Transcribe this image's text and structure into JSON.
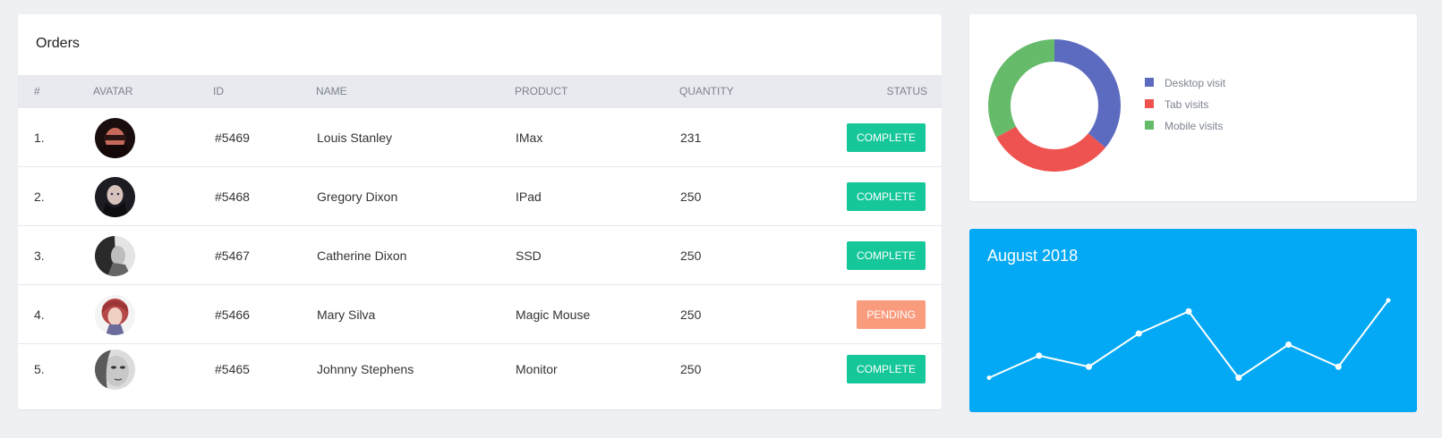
{
  "orders": {
    "title": "Orders",
    "columns": [
      "#",
      "AVATAR",
      "ID",
      "NAME",
      "PRODUCT",
      "QUANTITY",
      "STATUS"
    ],
    "rows": [
      {
        "num": "1.",
        "id": "#5469",
        "name": "Louis Stanley",
        "product": "IMax",
        "quantity": "231",
        "status": "COMPLETE"
      },
      {
        "num": "2.",
        "id": "#5468",
        "name": "Gregory Dixon",
        "product": "IPad",
        "quantity": "250",
        "status": "COMPLETE"
      },
      {
        "num": "3.",
        "id": "#5467",
        "name": "Catherine Dixon",
        "product": "SSD",
        "quantity": "250",
        "status": "COMPLETE"
      },
      {
        "num": "4.",
        "id": "#5466",
        "name": "Mary Silva",
        "product": "Magic Mouse",
        "quantity": "250",
        "status": "PENDING"
      },
      {
        "num": "5.",
        "id": "#5465",
        "name": "Johnny Stephens",
        "product": "Monitor",
        "quantity": "250",
        "status": "COMPLETE"
      }
    ]
  },
  "colors": {
    "complete": "#16c79a",
    "pending": "#f99b7d",
    "desktop": "#5c6bc0",
    "tab": "#ef5350",
    "mobile": "#66bb6a",
    "line_card": "#03a9f4"
  },
  "chart_data": [
    {
      "type": "pie",
      "variant": "donut",
      "series": [
        {
          "name": "Desktop visit",
          "value": 36,
          "color": "#5c6bc0"
        },
        {
          "name": "Tab visits",
          "value": 31,
          "color": "#ef5350"
        },
        {
          "name": "Mobile visits",
          "value": 33,
          "color": "#66bb6a"
        }
      ],
      "legend_position": "right"
    },
    {
      "type": "line",
      "title": "August 2018",
      "x": [
        1,
        2,
        3,
        4,
        5,
        6,
        7,
        8,
        9
      ],
      "values": [
        1,
        3,
        2,
        5,
        7,
        1,
        4,
        2,
        8
      ],
      "ylim": [
        0,
        8
      ],
      "grid": false
    }
  ]
}
